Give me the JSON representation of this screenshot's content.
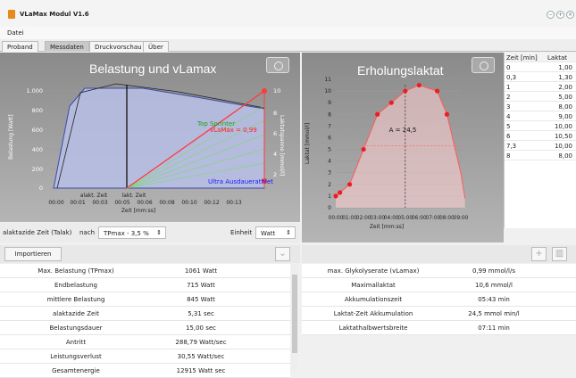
{
  "window": {
    "title": "VLaMax Modul V1.6",
    "menu": "Datei",
    "controls": [
      "−",
      "+",
      "×"
    ]
  },
  "tabs": [
    "Proband",
    "Messdaten",
    "Druckvorschau",
    "Über"
  ],
  "left_chart": {
    "title": "Belastung und vLamax",
    "y1label": "Belastung [Watt]",
    "y2label": "Laktatspanne [mmol/l]",
    "xlabel": "Zeit [mm:ss]",
    "y1ticks": [
      "1.000",
      "800",
      "600",
      "400",
      "200",
      "0"
    ],
    "y2ticks": [
      "10",
      "8",
      "6",
      "4",
      "2"
    ],
    "xticks": [
      "00:00",
      "00:01",
      "00:03",
      "00:05",
      "00:06",
      "00:08",
      "00:10",
      "00:12",
      "00:13"
    ],
    "marker1": "alakt. Zeit",
    "marker2": "lakt. Zeit",
    "top_label": "Top Sprinter",
    "vlamax_label": "vLaMax = 0,99",
    "bottom_label": "Ultra Ausdauerathlet"
  },
  "controls": {
    "talak_label": "alaktazide Zeit (Talak)",
    "nach": "nach",
    "talak_value": "TPmax - 3,5 %",
    "einheit_label": "Einheit",
    "einheit_value": "Watt"
  },
  "import_label": "Importieren",
  "results_left": [
    {
      "label": "Max. Belastung (TPmax)",
      "value": "1061 Watt"
    },
    {
      "label": "Endbelastung",
      "value": "715 Watt"
    },
    {
      "label": "mittlere Belastung",
      "value": "845 Watt"
    },
    {
      "label": "alaktazide Zeit",
      "value": "5,31 sec"
    },
    {
      "label": "Belastungsdauer",
      "value": "15,00 sec"
    },
    {
      "label": "Antritt",
      "value": "288,79 Watt/sec"
    },
    {
      "label": "Leistungsverlust",
      "value": "30,55 Watt/sec"
    },
    {
      "label": "Gesamtenergie",
      "value": "12915 Watt sec"
    }
  ],
  "results_right": [
    {
      "label": "max. Glykolyserate (vLamax)",
      "value": "0,99 mmol/l/s"
    },
    {
      "label": "Maximallaktat",
      "value": "10,6 mmol/l"
    },
    {
      "label": "Akkumulationszeit",
      "value": "05:43 min"
    },
    {
      "label": "Laktat-Zeit Akkumulation",
      "value": "24,5 mmol min/l"
    },
    {
      "label": "Laktathalbwertsbreite",
      "value": "07:11 min"
    }
  ],
  "chart_data": {
    "type": "scatter",
    "title": "Erholungslaktat",
    "xlabel": "Zeit [mm:ss]",
    "ylabel": "Laktat [mmol/l]",
    "ylim": [
      0,
      11
    ],
    "x": [
      0,
      0.3,
      1,
      2,
      3,
      4,
      5,
      6,
      7.3,
      8
    ],
    "y": [
      1,
      1.3,
      2,
      5,
      8,
      9,
      10,
      10.5,
      10,
      8
    ],
    "xticks": [
      "00:00",
      "01:00",
      "02:00",
      "03:00",
      "04:00",
      "05:00",
      "06:00",
      "07:00",
      "08:00",
      "09:00"
    ],
    "yticks": [
      "0",
      "1",
      "2",
      "3",
      "4",
      "5",
      "6",
      "7",
      "8",
      "9",
      "10",
      "11"
    ],
    "annotation": "A = 24,5"
  },
  "grid": {
    "headers": [
      "Zeit [min]",
      "Laktat"
    ],
    "rows": [
      [
        "0",
        "1,00"
      ],
      [
        "0,3",
        "1,30"
      ],
      [
        "1",
        "2,00"
      ],
      [
        "2",
        "5,00"
      ],
      [
        "3",
        "8,00"
      ],
      [
        "4",
        "9,00"
      ],
      [
        "5",
        "10,00"
      ],
      [
        "6",
        "10,50"
      ],
      [
        "7,3",
        "10,00"
      ],
      [
        "8",
        "8,00"
      ]
    ]
  }
}
